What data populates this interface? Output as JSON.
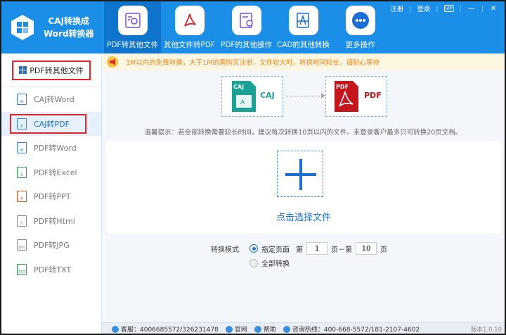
{
  "brand": {
    "line1": "CAJ转换成",
    "line2": "Word转换器"
  },
  "nav": [
    {
      "label": "PDF转其他文件",
      "active": true
    },
    {
      "label": "其他文件转PDF"
    },
    {
      "label": "PDF的其他操作"
    },
    {
      "label": "CAD的其他转换"
    },
    {
      "label": "更多操作"
    }
  ],
  "top_links": {
    "register": "注册",
    "login": "登录",
    "vip": "VIP"
  },
  "sidebar": {
    "header": "PDF转其他文件",
    "items": [
      {
        "label": "CAJ转Word",
        "icon_tag": "W"
      },
      {
        "label": "CAJ转PDF",
        "icon_tag": "P",
        "active": true
      },
      {
        "label": "PDF转Word",
        "icon_tag": "W"
      },
      {
        "label": "PDF转Excel",
        "icon_tag": "X"
      },
      {
        "label": "PDF转PPT",
        "icon_tag": "P"
      },
      {
        "label": "PDF转Html",
        "icon_tag": "H"
      },
      {
        "label": "PDF转JPG",
        "icon_tag": "JPG"
      },
      {
        "label": "PDF转TXT",
        "icon_tag": "TXT"
      }
    ]
  },
  "notice": "1M以内的免费转换，大于1M的需购买注册，文件较大时，转换时间较长，请耐心等待",
  "conversion": {
    "from_tag": "CAJ",
    "from_label": "CAJ",
    "to_tag": "PDF",
    "to_label": "PDF"
  },
  "hint": "温馨提示：若全部转换需要较长时间，建议每次转换10页以内的文件。未登录客户最多只可转换20页文档。",
  "drop": {
    "label": "点击选择文件"
  },
  "mode": {
    "label": "转换模式",
    "option_pages": "指定页面",
    "page_prefix": "第",
    "page_from": "1",
    "page_mid": "页－第",
    "page_to": "10",
    "page_suffix": "页",
    "option_all": "全部转换"
  },
  "footer": {
    "service": "客服：4006685572/326231478",
    "website": "官网",
    "help": "帮助",
    "hotline": "咨询热线：400-668-5572/181-2107-4602",
    "version": "版本1.0.10"
  },
  "colors": {
    "header": "#1b8ee8",
    "active_nav": "#0f74cc",
    "accent": "#1b6fd6",
    "highlight_border": "#e0262b",
    "caj": "#1aa394",
    "pdf": "#c4161c"
  }
}
